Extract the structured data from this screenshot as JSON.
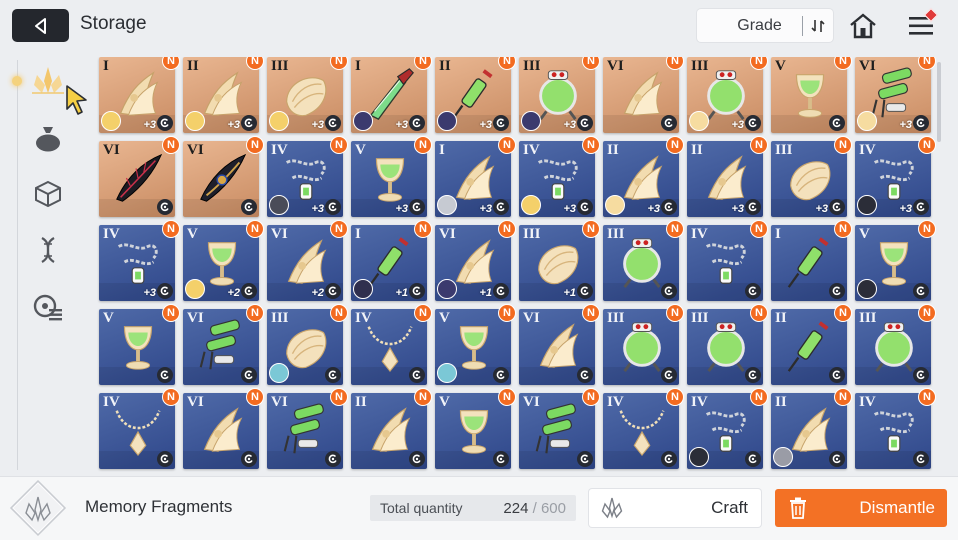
{
  "header": {
    "title": "Storage",
    "sort_label": "Grade"
  },
  "sidebar": {
    "tabs": [
      {
        "name": "memory-fragments-tab",
        "icon": "memory-fragment-icon",
        "active": true
      },
      {
        "name": "materials-tab",
        "icon": "pouch-icon"
      },
      {
        "name": "items-tab",
        "icon": "cube-icon"
      },
      {
        "name": "genes-tab",
        "icon": "dna-icon"
      },
      {
        "name": "records-tab",
        "icon": "disk-list-icon"
      }
    ]
  },
  "colors": {
    "accent": "#f37125",
    "rare_card": "#d79a6f",
    "common_card": "#3e579a",
    "badge": "#f36b20"
  },
  "items": [
    {
      "grade": "I",
      "bg": "orange",
      "art": "claw",
      "level": "+3",
      "avatar": "#f4d06a"
    },
    {
      "grade": "II",
      "bg": "orange",
      "art": "claw",
      "level": "+3",
      "avatar": "#f4d06a"
    },
    {
      "grade": "III",
      "bg": "orange",
      "art": "shell",
      "level": "+3",
      "avatar": "#f4d06a"
    },
    {
      "grade": "I",
      "bg": "orange",
      "art": "blade",
      "level": "+3",
      "avatar": "#3b3a6e"
    },
    {
      "grade": "II",
      "bg": "orange",
      "art": "syringe",
      "level": "+3",
      "avatar": "#3b3a6e"
    },
    {
      "grade": "III",
      "bg": "orange",
      "art": "flask",
      "level": "+3",
      "avatar": "#3b3a6e"
    },
    {
      "grade": "VI",
      "bg": "orange",
      "art": "claw",
      "level": "",
      "avatar": ""
    },
    {
      "grade": "III",
      "bg": "orange",
      "art": "flask",
      "level": "+3",
      "avatar": "#f6dca0"
    },
    {
      "grade": "V",
      "bg": "orange",
      "art": "goblet",
      "level": "",
      "avatar": ""
    },
    {
      "grade": "VI",
      "bg": "orange",
      "art": "tubes",
      "level": "+3",
      "avatar": "#f6dca0"
    },
    {
      "grade": "VI",
      "bg": "orange",
      "art": "feather",
      "level": "",
      "avatar": ""
    },
    {
      "grade": "VI",
      "bg": "orange",
      "art": "feather2",
      "level": "",
      "avatar": ""
    },
    {
      "grade": "IV",
      "bg": "blue",
      "art": "chain",
      "level": "+3",
      "avatar": "#4a4c58"
    },
    {
      "grade": "V",
      "bg": "blue",
      "art": "goblet",
      "level": "+3",
      "avatar": ""
    },
    {
      "grade": "I",
      "bg": "blue",
      "art": "claw",
      "level": "+3",
      "avatar": "#c6cad2"
    },
    {
      "grade": "IV",
      "bg": "blue",
      "art": "chain",
      "level": "+3",
      "avatar": "#f4d06a"
    },
    {
      "grade": "II",
      "bg": "blue",
      "art": "claw",
      "level": "+3",
      "avatar": "#f6dca0"
    },
    {
      "grade": "II",
      "bg": "blue",
      "art": "claw",
      "level": "+3",
      "avatar": ""
    },
    {
      "grade": "III",
      "bg": "blue",
      "art": "shell",
      "level": "+3",
      "avatar": ""
    },
    {
      "grade": "IV",
      "bg": "blue",
      "art": "chain",
      "level": "+3",
      "avatar": "#2b2d38"
    },
    {
      "grade": "IV",
      "bg": "blue",
      "art": "chain",
      "level": "+3",
      "avatar": ""
    },
    {
      "grade": "V",
      "bg": "blue",
      "art": "goblet",
      "level": "+2",
      "avatar": "#f4d06a"
    },
    {
      "grade": "VI",
      "bg": "blue",
      "art": "claw",
      "level": "+2",
      "avatar": ""
    },
    {
      "grade": "I",
      "bg": "blue",
      "art": "syringe",
      "level": "+1",
      "avatar": "#2f2f4e"
    },
    {
      "grade": "VI",
      "bg": "blue",
      "art": "claw",
      "level": "+1",
      "avatar": "#3b3a6e"
    },
    {
      "grade": "III",
      "bg": "blue",
      "art": "shell",
      "level": "+1",
      "avatar": ""
    },
    {
      "grade": "III",
      "bg": "blue",
      "art": "flask",
      "level": "",
      "avatar": ""
    },
    {
      "grade": "IV",
      "bg": "blue",
      "art": "chain",
      "level": "",
      "avatar": ""
    },
    {
      "grade": "I",
      "bg": "blue",
      "art": "syringe",
      "level": "",
      "avatar": ""
    },
    {
      "grade": "V",
      "bg": "blue",
      "art": "goblet",
      "level": "",
      "avatar": "#2b2d38"
    },
    {
      "grade": "V",
      "bg": "blue",
      "art": "goblet",
      "level": "",
      "avatar": ""
    },
    {
      "grade": "VI",
      "bg": "blue",
      "art": "tubes",
      "level": "",
      "avatar": ""
    },
    {
      "grade": "III",
      "bg": "blue",
      "art": "shell",
      "level": "",
      "avatar": "#7bc8d6"
    },
    {
      "grade": "IV",
      "bg": "blue",
      "art": "necklace",
      "level": "",
      "avatar": ""
    },
    {
      "grade": "V",
      "bg": "blue",
      "art": "goblet",
      "level": "",
      "avatar": "#7bc8d6"
    },
    {
      "grade": "VI",
      "bg": "blue",
      "art": "claw",
      "level": "",
      "avatar": ""
    },
    {
      "grade": "III",
      "bg": "blue",
      "art": "flask",
      "level": "",
      "avatar": ""
    },
    {
      "grade": "III",
      "bg": "blue",
      "art": "flask",
      "level": "",
      "avatar": ""
    },
    {
      "grade": "II",
      "bg": "blue",
      "art": "syringe",
      "level": "",
      "avatar": ""
    },
    {
      "grade": "III",
      "bg": "blue",
      "art": "flask",
      "level": "",
      "avatar": ""
    },
    {
      "grade": "IV",
      "bg": "blue",
      "art": "necklace",
      "level": "",
      "avatar": ""
    },
    {
      "grade": "VI",
      "bg": "blue",
      "art": "claw",
      "level": "",
      "avatar": ""
    },
    {
      "grade": "VI",
      "bg": "blue",
      "art": "tubes",
      "level": "",
      "avatar": ""
    },
    {
      "grade": "II",
      "bg": "blue",
      "art": "claw",
      "level": "",
      "avatar": ""
    },
    {
      "grade": "V",
      "bg": "blue",
      "art": "goblet",
      "level": "",
      "avatar": ""
    },
    {
      "grade": "VI",
      "bg": "blue",
      "art": "tubes",
      "level": "",
      "avatar": ""
    },
    {
      "grade": "IV",
      "bg": "blue",
      "art": "necklace",
      "level": "",
      "avatar": ""
    },
    {
      "grade": "IV",
      "bg": "blue",
      "art": "chain",
      "level": "",
      "avatar": "#2b2d38"
    },
    {
      "grade": "II",
      "bg": "blue",
      "art": "claw",
      "level": "",
      "avatar": "#9a9ca6"
    },
    {
      "grade": "IV",
      "bg": "blue",
      "art": "chain",
      "level": "",
      "avatar": ""
    }
  ],
  "footer": {
    "category_label": "Memory Fragments",
    "total_label": "Total quantity",
    "total_count": "224",
    "total_sep": " / ",
    "total_max": "600",
    "craft_label": "Craft",
    "dismantle_label": "Dismantle"
  }
}
